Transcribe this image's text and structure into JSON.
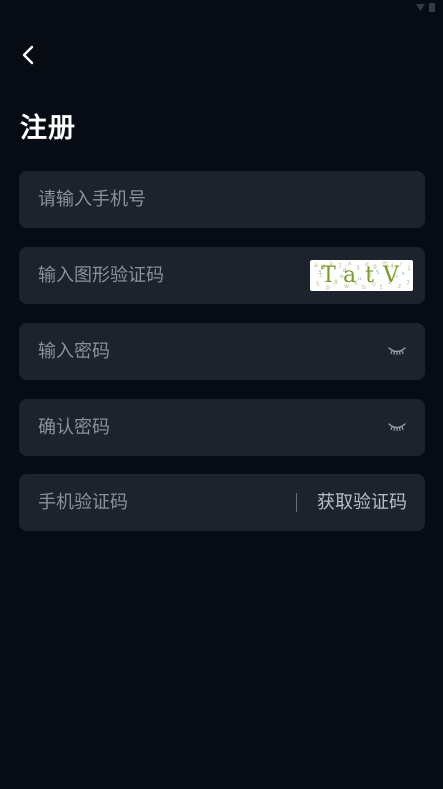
{
  "page": {
    "title": "注册"
  },
  "form": {
    "phone": {
      "placeholder": "请输入手机号",
      "value": ""
    },
    "captcha": {
      "placeholder": "输入图形验证码",
      "value": "",
      "image_text": "TatV"
    },
    "password": {
      "placeholder": "输入密码",
      "value": ""
    },
    "confirm_password": {
      "placeholder": "确认密码",
      "value": ""
    },
    "sms_code": {
      "placeholder": "手机验证码",
      "value": "",
      "button_label": "获取验证码"
    }
  },
  "icons": {
    "back": "chevron-left-icon",
    "eye": "eye-closed-icon"
  },
  "colors": {
    "background": "#070c14",
    "field": "#1c232d",
    "placeholder": "#8b9099",
    "captcha_text": "#7a9a2a"
  }
}
